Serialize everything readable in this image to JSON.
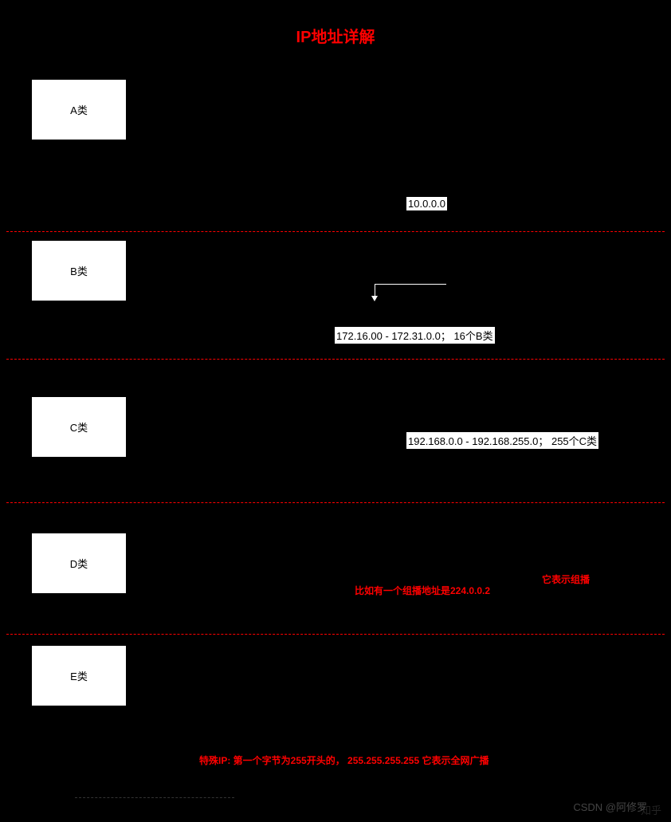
{
  "title": "IP地址详解",
  "sections": {
    "A": {
      "label": "A类",
      "note_highlight": "10.0.0.0"
    },
    "B": {
      "label": "B类",
      "bracket_char": "<",
      "note_highlight": "172.16.00 - 172.31.0.0；  16个B类"
    },
    "C": {
      "label": "C类",
      "note_highlight": "192.168.0.0 - 192.168.255.0； 255个C类"
    },
    "D": {
      "label": "D类",
      "red_note_left": "比如有一个组播地址是224.0.0.2",
      "red_note_right": "它表示组播"
    },
    "E": {
      "label": "E类",
      "red_note": "特殊IP: 第一个字节为255开头的，  255.255.255.255  它表示全网广播"
    }
  },
  "watermark1": "CSDN @阿修罗",
  "watermark2": "知乎"
}
